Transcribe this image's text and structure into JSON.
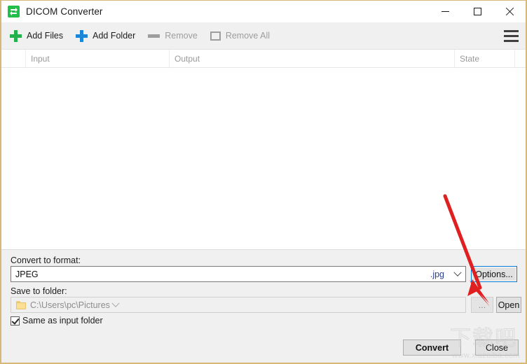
{
  "window": {
    "title": "DICOM Converter",
    "icon": "convert-arrows-icon",
    "controls": {
      "minimize": "—",
      "maximize": "□",
      "close": "✕"
    }
  },
  "toolbar": {
    "add_files": "Add Files",
    "add_folder": "Add Folder",
    "remove": "Remove",
    "remove_all": "Remove All",
    "menu": "menu-icon"
  },
  "list": {
    "columns": [
      {
        "label": "Input"
      },
      {
        "label": "Output"
      },
      {
        "label": "State"
      }
    ],
    "rows": []
  },
  "bottom": {
    "format_label": "Convert to format:",
    "format_value": "JPEG",
    "format_extension": ".jpg",
    "options_button": "Options...",
    "folder_label": "Save to folder:",
    "folder_value": "C:\\Users\\pc\\Pictures",
    "browse_button": "...",
    "open_button": "Open",
    "same_as_input_label": "Same as input folder",
    "same_as_input_checked": true,
    "convert_button": "Convert",
    "close_button": "Close"
  },
  "annotation": {
    "arrow_color": "#e02020"
  },
  "watermark": {
    "text_cn": "下载吧",
    "url": "www.xiazaiba.com"
  }
}
